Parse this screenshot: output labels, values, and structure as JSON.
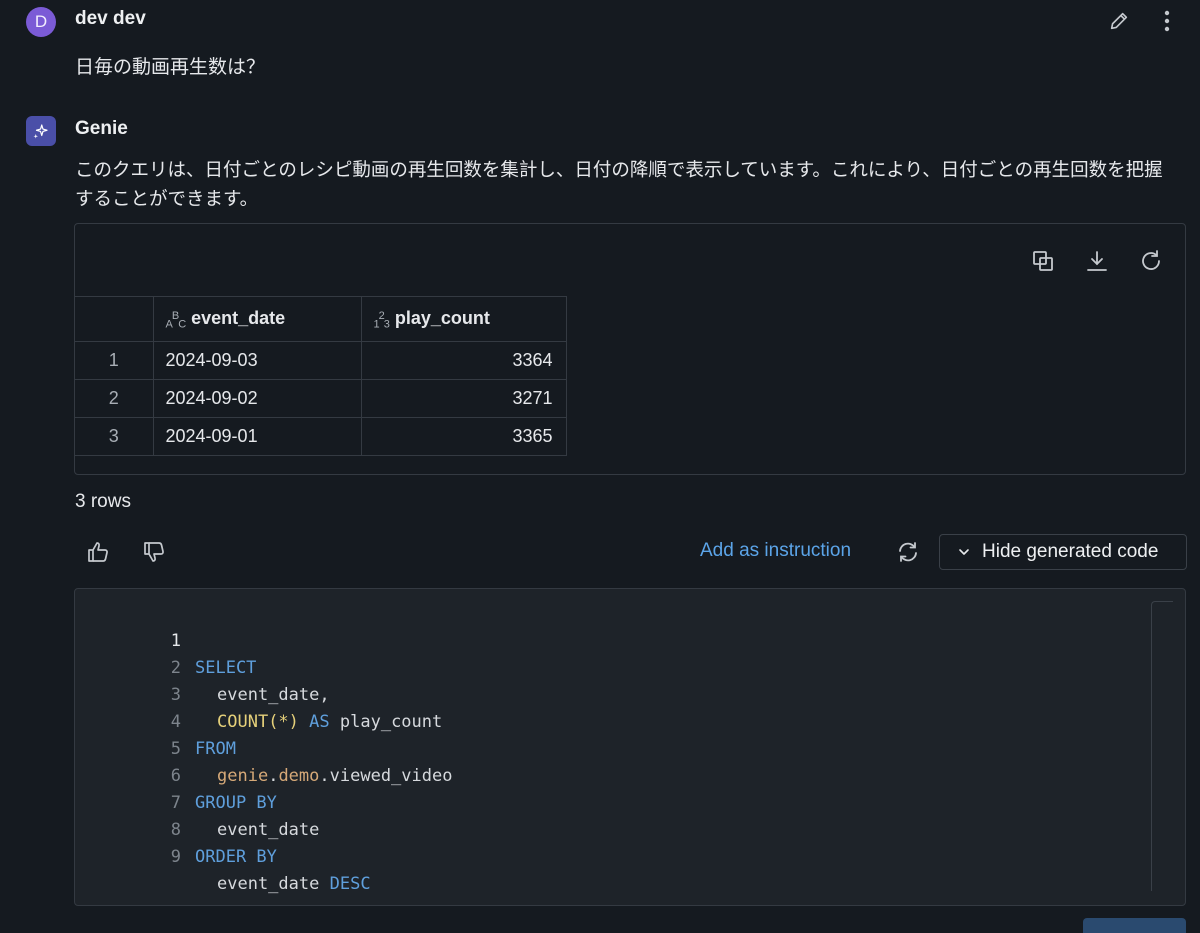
{
  "user": {
    "avatar_letter": "D",
    "name": "dev dev",
    "message": "日毎の動画再生数は？"
  },
  "genie": {
    "name": "Genie",
    "description": "このクエリは、日付ごとのレシピ動画の再生回数を集計し、日付の降順で表示しています。これにより、日付ごとの再生回数を把握することができます。"
  },
  "result": {
    "columns": [
      {
        "type_icon": "ABC",
        "name": "event_date"
      },
      {
        "type_icon": "123",
        "name": "play_count"
      }
    ],
    "rows": [
      {
        "index": "1",
        "event_date": "2024-09-03",
        "play_count": "3364"
      },
      {
        "index": "2",
        "event_date": "2024-09-02",
        "play_count": "3271"
      },
      {
        "index": "3",
        "event_date": "2024-09-01",
        "play_count": "3365"
      }
    ],
    "row_count_label": "3 rows"
  },
  "actions": {
    "add_instruction": "Add as instruction",
    "hide_code": "Hide generated code"
  },
  "code": {
    "lines": [
      {
        "n": "1"
      },
      {
        "n": "2"
      },
      {
        "n": "3"
      },
      {
        "n": "4"
      },
      {
        "n": "5"
      },
      {
        "n": "6"
      },
      {
        "n": "7"
      },
      {
        "n": "8"
      },
      {
        "n": "9"
      }
    ],
    "l1_kw": "SELECT",
    "l2_text": "event_date,",
    "l3_fn": "COUNT",
    "l3_args": "(*)",
    "l3_kw": "AS",
    "l3_alias": "play_count",
    "l4_kw": "FROM",
    "l5_catalog": "genie",
    "l5_schema": "demo",
    "l5_table": "viewed_video",
    "l6_kw": "GROUP BY",
    "l7_text": "event_date",
    "l8_kw": "ORDER BY",
    "l9_text": "event_date",
    "l9_kw": "DESC"
  },
  "colors": {
    "background": "#151a20",
    "accent_link": "#5ba4e8",
    "user_avatar": "#7b5bd6",
    "genie_avatar": "#4a4fa8",
    "sql_keyword": "#5f9fdc"
  },
  "icons": [
    "pencil-icon",
    "kebab-menu-icon",
    "sparkle-icon",
    "copy-icon",
    "download-icon",
    "refresh-icon",
    "thumbs-up-icon",
    "thumbs-down-icon",
    "chevron-down-icon"
  ]
}
